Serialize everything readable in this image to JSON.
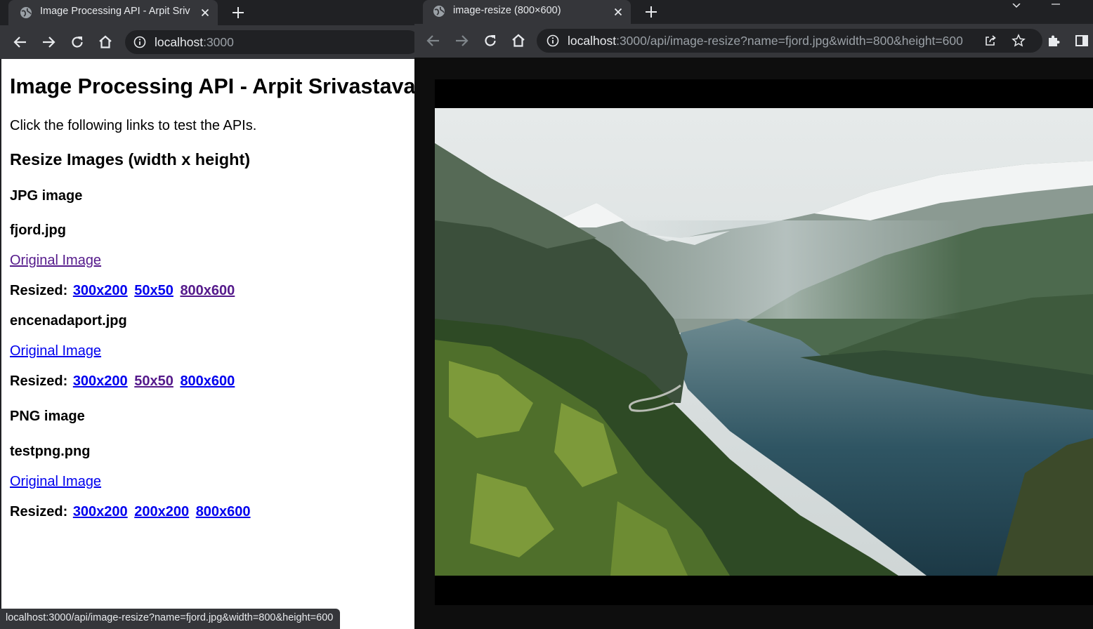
{
  "left_window": {
    "tab": {
      "title": "Image Processing API - Arpit Sriv",
      "favicon": "globe-icon",
      "close": "close-icon"
    },
    "new_tab": "plus-icon",
    "toolbar": {
      "back": "back-arrow-icon",
      "forward": "forward-arrow-icon",
      "reload": "reload-icon",
      "home": "home-icon"
    },
    "omnibox": {
      "host": "localhost",
      "rest": ":3000",
      "info": "info-icon"
    },
    "page": {
      "title": "Image Processing API - Arpit Srivastava",
      "intro": "Click the following links to test the APIs.",
      "section": "Resize Images (width x height)",
      "jpg_heading": "JPG image",
      "png_heading": "PNG image",
      "original_label": "Original Image",
      "resized_label": "Resized:",
      "images": [
        {
          "name": "fjord.jpg",
          "sizes": [
            "300x200",
            "50x50",
            "800x600"
          ]
        },
        {
          "name": "encenadaport.jpg",
          "sizes": [
            "300x200",
            "50x50",
            "800x600"
          ]
        },
        {
          "name": "testpng.png",
          "sizes": [
            "300x200",
            "200x200",
            "800x600"
          ]
        }
      ]
    },
    "status_url": "localhost:3000/api/image-resize?name=fjord.jpg&width=800&height=600"
  },
  "right_window": {
    "tab": {
      "title": "image-resize (800×600)",
      "favicon": "globe-icon",
      "close": "close-icon"
    },
    "new_tab": "plus-icon",
    "toolbar": {
      "back": "back-arrow-icon",
      "forward": "forward-arrow-icon",
      "reload": "reload-icon",
      "home": "home-icon",
      "share": "share-icon",
      "bookmark": "star-icon",
      "extensions": "puzzle-icon",
      "sidepanel": "side-panel-icon"
    },
    "omnibox": {
      "host": "localhost",
      "rest": ":3000/api/image-resize?name=fjord.jpg&width=800&height=600",
      "info": "info-icon"
    },
    "image": {
      "alt": "fjord landscape photo",
      "size": "800x600"
    }
  },
  "colors": {
    "link": "#0000ee",
    "visited_link": "#551a8b",
    "chrome_dark": "#202124",
    "chrome_tab": "#35363a"
  }
}
